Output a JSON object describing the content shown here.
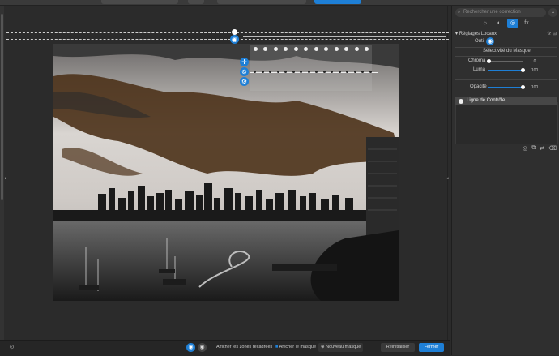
{
  "panel": {
    "search_placeholder": "Rechercher une correction",
    "search_clear": "×",
    "tabs": [
      "☼",
      "◐",
      "◎",
      "fx"
    ],
    "section_title": "Réglages Locaux",
    "tool_label": "Outil",
    "mask_selectivity_title": "Sélectivité du Masque",
    "chroma": {
      "label": "Chroma",
      "value": "0"
    },
    "luma": {
      "label": "Luma",
      "value": "100"
    },
    "opacity": {
      "label": "Opacité",
      "value": "100"
    },
    "line_item": "Ligne de Contrôle"
  },
  "bottombar": {
    "show_crop_zones": "Afficher les zones recadrées",
    "show_mask": "Afficher le masque",
    "new_mask": "Nouveau masque",
    "reset": "Réinitialiser",
    "close": "Fermer"
  },
  "colors": {
    "accent": "#1e7fd6",
    "sepia": "#5a3a1d"
  }
}
